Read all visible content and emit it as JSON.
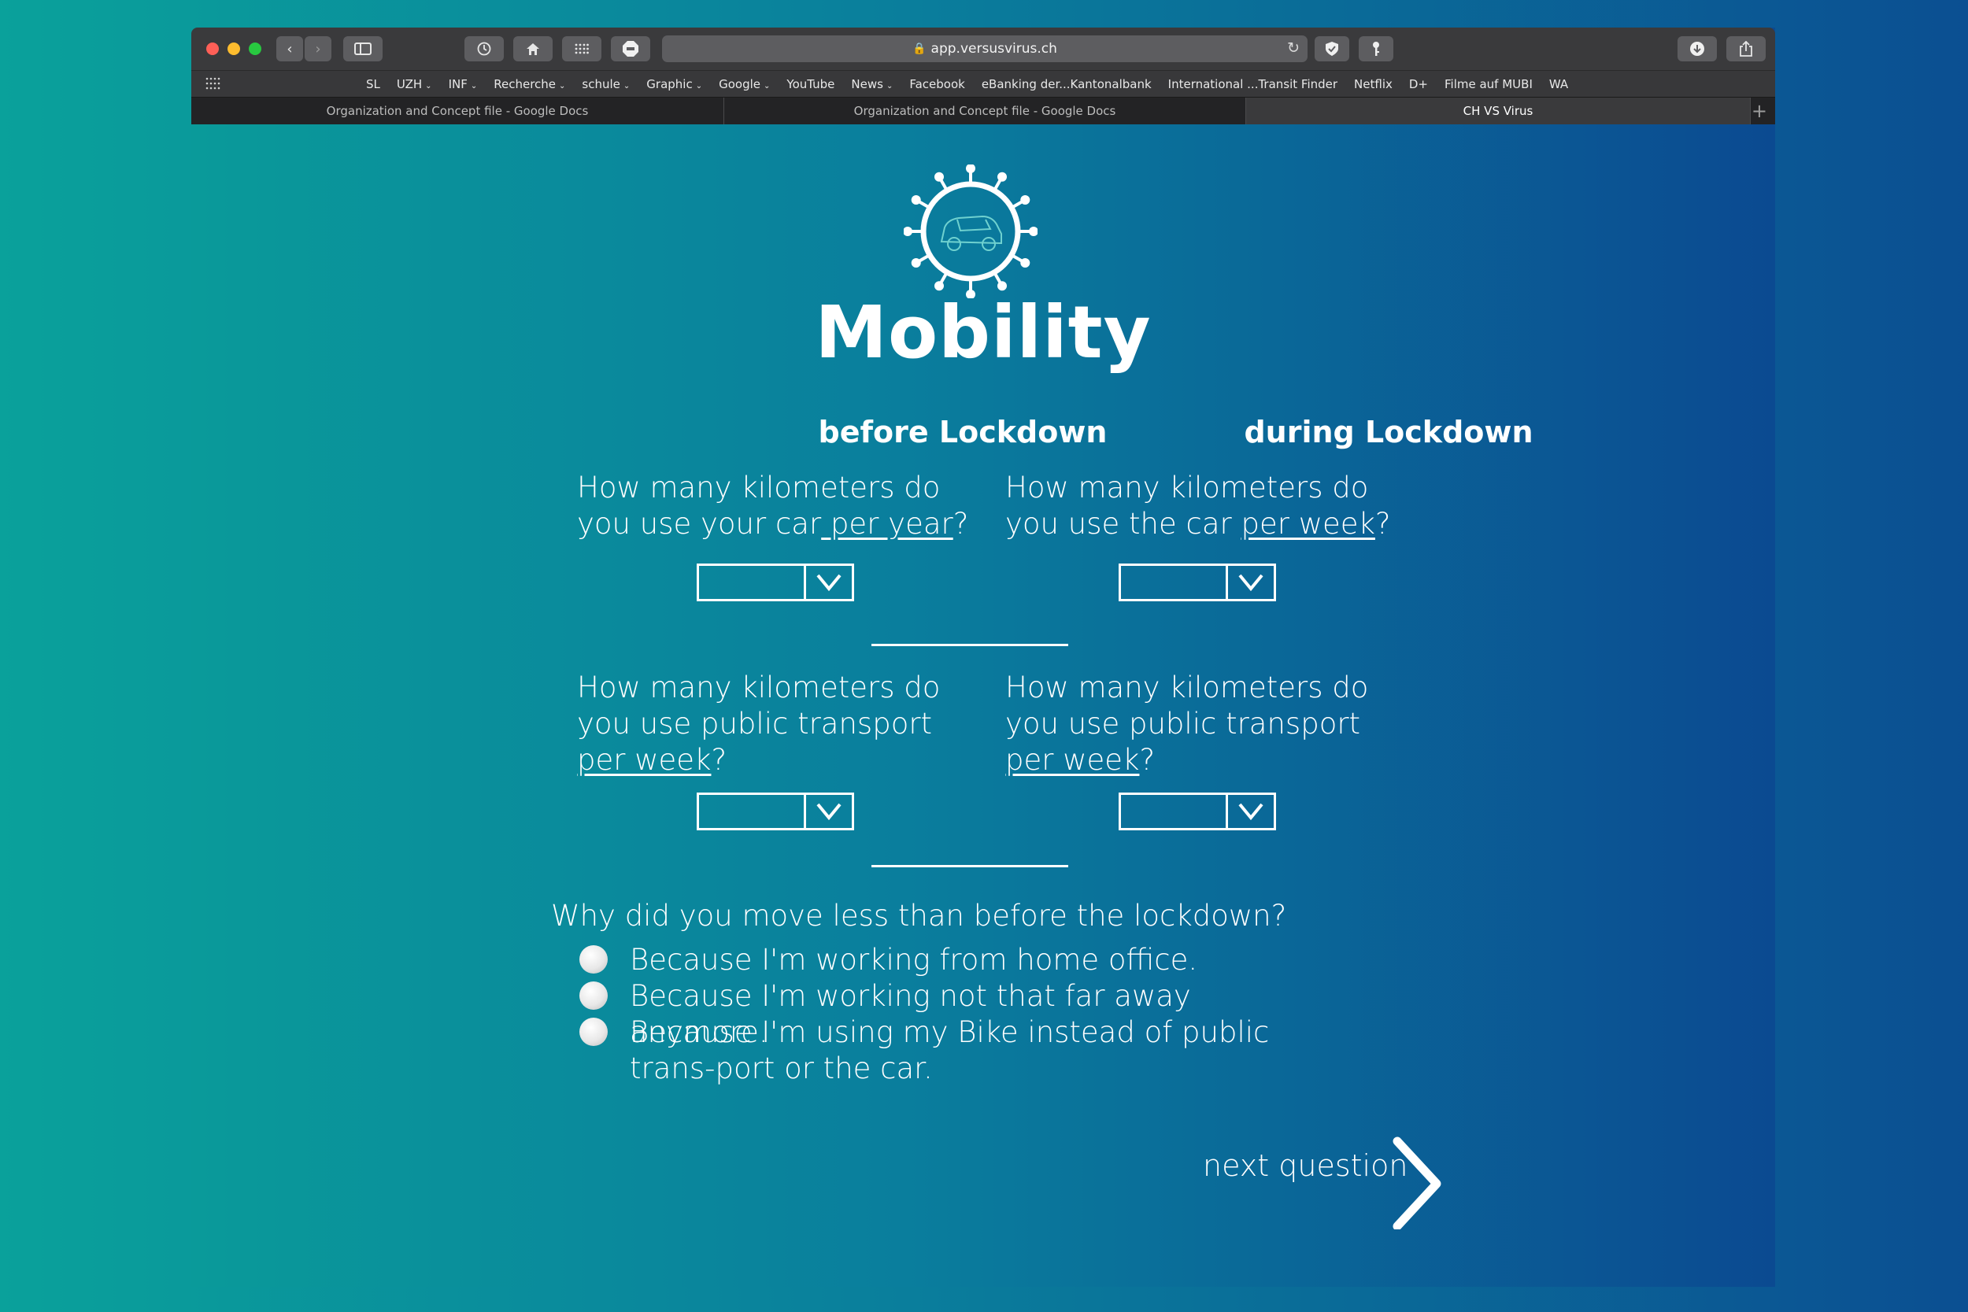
{
  "browser": {
    "url": "app.versusvirus.ch",
    "bookmarks": [
      {
        "label": "SL",
        "menu": false
      },
      {
        "label": "UZH",
        "menu": true
      },
      {
        "label": "INF",
        "menu": true
      },
      {
        "label": "Recherche",
        "menu": true
      },
      {
        "label": "schule",
        "menu": true
      },
      {
        "label": "Graphic",
        "menu": true
      },
      {
        "label": "Google",
        "menu": true
      },
      {
        "label": "YouTube",
        "menu": false
      },
      {
        "label": "News",
        "menu": true
      },
      {
        "label": "Facebook",
        "menu": false
      },
      {
        "label": "eBanking der...Kantonalbank",
        "menu": false
      },
      {
        "label": "International ...Transit Finder",
        "menu": false
      },
      {
        "label": "Netflix",
        "menu": false
      },
      {
        "label": "D+",
        "menu": false
      },
      {
        "label": "Filme auf MUBI",
        "menu": false
      },
      {
        "label": "WA",
        "menu": false
      }
    ],
    "tabs": [
      {
        "label": "Organization and Concept file - Google Docs",
        "active": false
      },
      {
        "label": "Organization and Concept file - Google Docs",
        "active": false
      },
      {
        "label": "CH VS Virus",
        "active": true
      }
    ]
  },
  "page": {
    "title": "Mobility",
    "before_heading": "before Lockdown",
    "during_heading": "during Lockdown",
    "q1_before": {
      "pre": "How many kilometers do you use your car",
      "u": " per year",
      "post": "?"
    },
    "q1_during": {
      "pre": "How many kilometers do you use the car ",
      "u": "per week",
      "post": "?"
    },
    "q2_before": {
      "pre": "How many kilometers do you use public transport ",
      "u": "per week",
      "post": "?"
    },
    "q2_during": {
      "pre": "How many kilometers do you use public transport ",
      "u": "per week",
      "post": "?"
    },
    "reason_question": "Why did you move less than before the lockdown?",
    "options": [
      "Because I'm working from home office.",
      "Because I'm working not that far away anymore.",
      "Because I'm using my Bike instead of public trans-port or the car."
    ],
    "next_label": "next question"
  }
}
